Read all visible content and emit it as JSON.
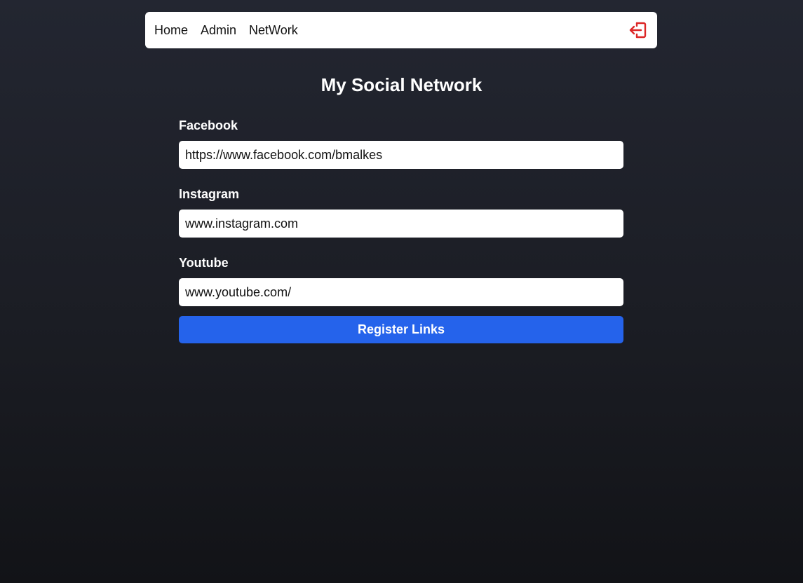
{
  "nav": {
    "items": [
      {
        "label": "Home"
      },
      {
        "label": "Admin"
      },
      {
        "label": "NetWork"
      }
    ],
    "logout_icon": "logout-icon",
    "logout_color": "#dc2626"
  },
  "page": {
    "title": "My Social Network"
  },
  "form": {
    "fields": [
      {
        "label": "Facebook",
        "value": "https://www.facebook.com/bmalkes"
      },
      {
        "label": "Instagram",
        "value": "www.instagram.com"
      },
      {
        "label": "Youtube",
        "value": "www.youtube.com/"
      }
    ],
    "submit_label": "Register Links",
    "submit_color": "#2563eb"
  }
}
